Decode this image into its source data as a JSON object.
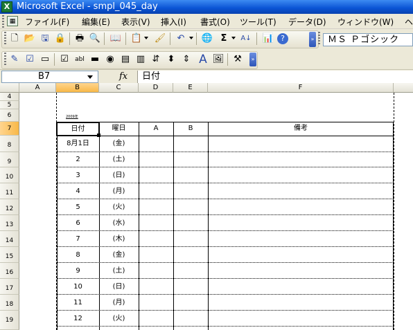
{
  "window": {
    "title": "Microsoft Excel - smpl_045_day",
    "app_icon_label": "X"
  },
  "menu": [
    {
      "label": "ファイル(F)"
    },
    {
      "label": "編集(E)"
    },
    {
      "label": "表示(V)"
    },
    {
      "label": "挿入(I)"
    },
    {
      "label": "書式(O)"
    },
    {
      "label": "ツール(T)"
    },
    {
      "label": "データ(D)"
    },
    {
      "label": "ウィンドウ(W)"
    },
    {
      "label": "ヘ"
    }
  ],
  "toolbar_standard": {
    "icons": [
      "new-icon",
      "open-icon",
      "save-icon",
      "permission-icon",
      "print-icon",
      "print-preview-icon",
      "research-icon",
      "paste-icon",
      "format-painter-icon",
      "undo-icon",
      "hyperlink-icon",
      "autosum-icon",
      "sort-ascending-icon",
      "chart-wizard-icon",
      "help-icon"
    ],
    "font_name": "ＭＳ Ｐゴシック"
  },
  "toolbar_forms": {
    "icons": [
      "edit-text-icon",
      "checkbox-icon",
      "edit-box-icon",
      "button-icon",
      "option-button-icon",
      "list-box-icon",
      "combo-box-icon",
      "scroll-bar-icon",
      "spinner-icon",
      "label-icon",
      "image-icon",
      "properties-icon"
    ]
  },
  "formula_bar": {
    "name_box": "B7",
    "fx_label": "fx",
    "content": "日付"
  },
  "sheet": {
    "columns": [
      "A",
      "B",
      "C",
      "D",
      "E",
      "F"
    ],
    "selected_column": "B",
    "rows": [
      "4",
      "5",
      "6",
      "7",
      "8",
      "9",
      "10",
      "11",
      "12",
      "13",
      "14",
      "15",
      "16",
      "17",
      "18",
      "19"
    ],
    "selected_row": "7",
    "tiny_note": "2009年",
    "table_headers": {
      "date": "日付",
      "weekday": "曜日",
      "a": "A",
      "b": "B",
      "note": "備考"
    },
    "data_rows": [
      {
        "date": "8月1日",
        "weekday": "(金)"
      },
      {
        "date": "2",
        "weekday": "(土)"
      },
      {
        "date": "3",
        "weekday": "(日)"
      },
      {
        "date": "4",
        "weekday": "(月)"
      },
      {
        "date": "5",
        "weekday": "(火)"
      },
      {
        "date": "6",
        "weekday": "(水)"
      },
      {
        "date": "7",
        "weekday": "(木)"
      },
      {
        "date": "8",
        "weekday": "(金)"
      },
      {
        "date": "9",
        "weekday": "(土)"
      },
      {
        "date": "10",
        "weekday": "(日)"
      },
      {
        "date": "11",
        "weekday": "(月)"
      },
      {
        "date": "12",
        "weekday": "(火)"
      }
    ]
  }
}
